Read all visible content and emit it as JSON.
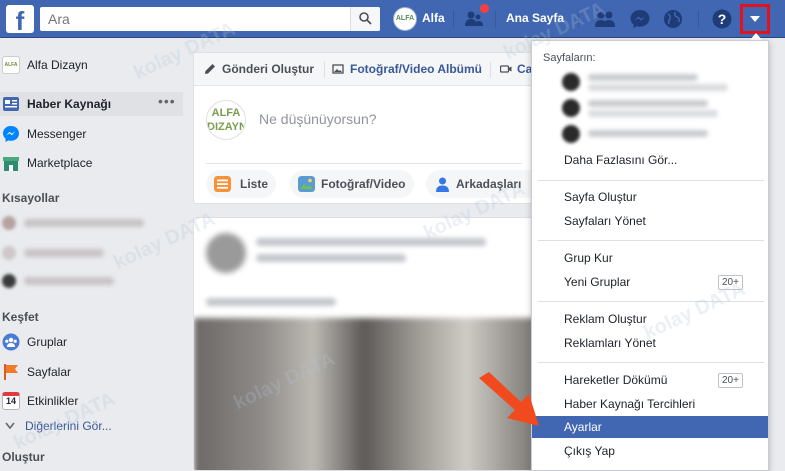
{
  "topbar": {
    "logo": "f",
    "search_placeholder": "Ara",
    "profile_initials": "ALFA",
    "profile_name": "Alfa",
    "home_label": "Ana Sayfa",
    "accent_color": "#4267b2"
  },
  "sidebar": {
    "profile_initials": "ALFA",
    "profile_name": "Alfa Dizayn",
    "items": [
      {
        "label": "Haber Kaynağı",
        "icon": "news-feed-icon",
        "active": true
      },
      {
        "label": "Messenger",
        "icon": "messenger-icon"
      },
      {
        "label": "Marketplace",
        "icon": "marketplace-icon"
      }
    ],
    "more_dots": "•••",
    "shortcuts_header": "Kısayollar",
    "explore_header": "Keşfet",
    "explore_items": [
      {
        "label": "Gruplar",
        "icon": "groups-icon"
      },
      {
        "label": "Sayfalar",
        "icon": "pages-flag-icon"
      },
      {
        "label": "Etkinlikler",
        "icon": "calendar-icon",
        "day": "14"
      }
    ],
    "see_more": "Diğerlerini Gör...",
    "create_header": "Oluştur"
  },
  "composer": {
    "tabs": [
      {
        "label": "Gönderi Oluştur",
        "icon": "pencil-icon"
      },
      {
        "label": "Fotoğraf/Video Albümü",
        "icon": "album-icon"
      },
      {
        "label": "Ca",
        "icon": "video-camera-icon"
      }
    ],
    "avatar_text": "ALFA DIZAYN",
    "placeholder": "Ne düşünüyorsun?",
    "actions": [
      {
        "label": "Liste",
        "icon": "list-icon"
      },
      {
        "label": "Fotoğraf/Video",
        "icon": "photo-icon"
      },
      {
        "label": "Arkadaşları",
        "icon": "tag-friends-icon"
      }
    ]
  },
  "menu": {
    "header": "Sayfaların:",
    "see_more": "Daha Fazlasını Gör...",
    "create_page": "Sayfa Oluştur",
    "manage_pages": "Sayfaları Yönet",
    "create_group": "Grup Kur",
    "new_groups": "Yeni Gruplar",
    "new_groups_badge": "20+",
    "create_ad": "Reklam Oluştur",
    "manage_ads": "Reklamları Yönet",
    "activity_log": "Hareketler Dökümü",
    "activity_badge": "20+",
    "news_feed_prefs": "Haber Kaynağı Tercihleri",
    "settings": "Ayarlar",
    "logout": "Çıkış Yap",
    "selected_color": "#4267b2"
  },
  "watermark": "kolay DATA",
  "highlight_color": "#e0131e",
  "arrow_color": "#f04a1e"
}
